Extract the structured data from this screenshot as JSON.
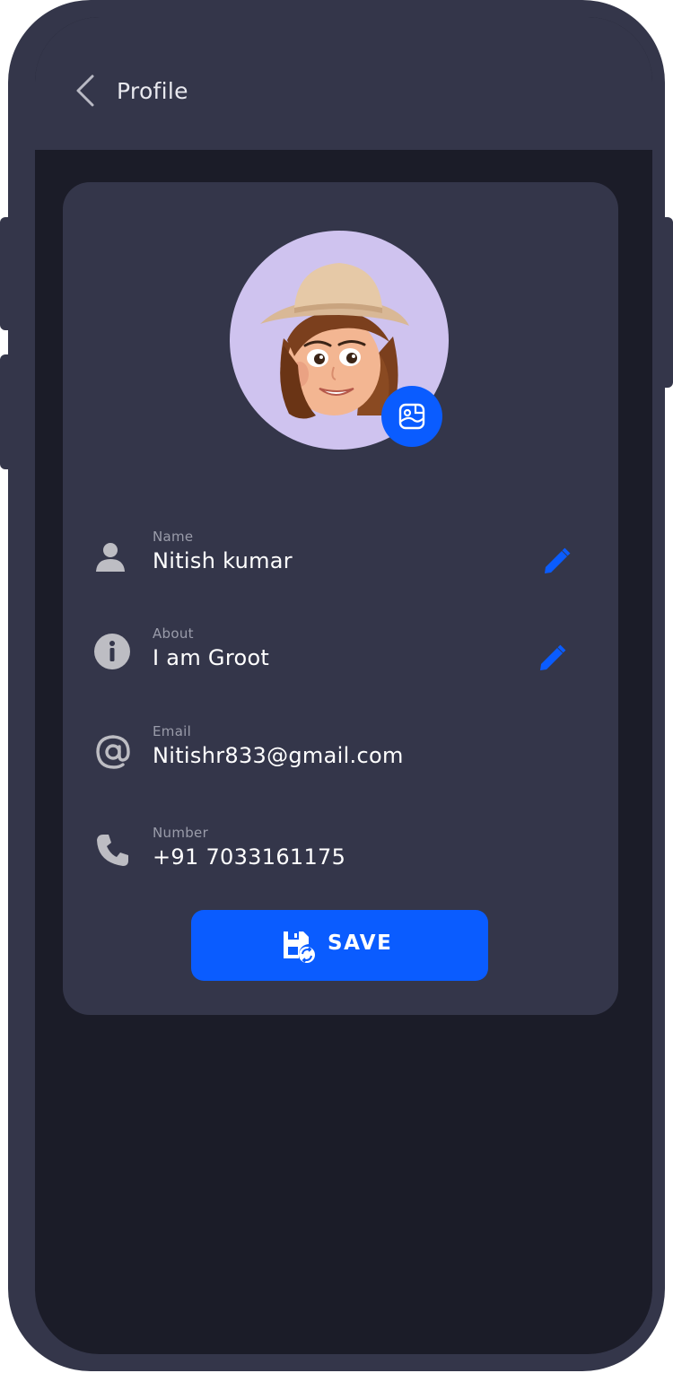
{
  "header": {
    "title": "Profile",
    "back_icon": "chevron-left-icon"
  },
  "avatar": {
    "edit_icon": "image-edit-icon"
  },
  "fields": [
    {
      "label": "Name",
      "value": "Nitish kumar",
      "icon": "person-icon",
      "editable": true
    },
    {
      "label": "About",
      "value": "I am Groot",
      "icon": "info-icon",
      "editable": true
    },
    {
      "label": "Email",
      "value": "Nitishr833@gmail.com",
      "icon": "at-icon",
      "editable": false
    },
    {
      "label": "Number",
      "value": "+91 7033161175",
      "icon": "phone-icon",
      "editable": false
    }
  ],
  "save_button": {
    "label": "SAVE",
    "icon": "save-sync-icon"
  },
  "colors": {
    "accent": "#0a5cff",
    "surface": "#34364a",
    "background": "#1b1c28",
    "avatar_bg": "#cfc3ef"
  }
}
